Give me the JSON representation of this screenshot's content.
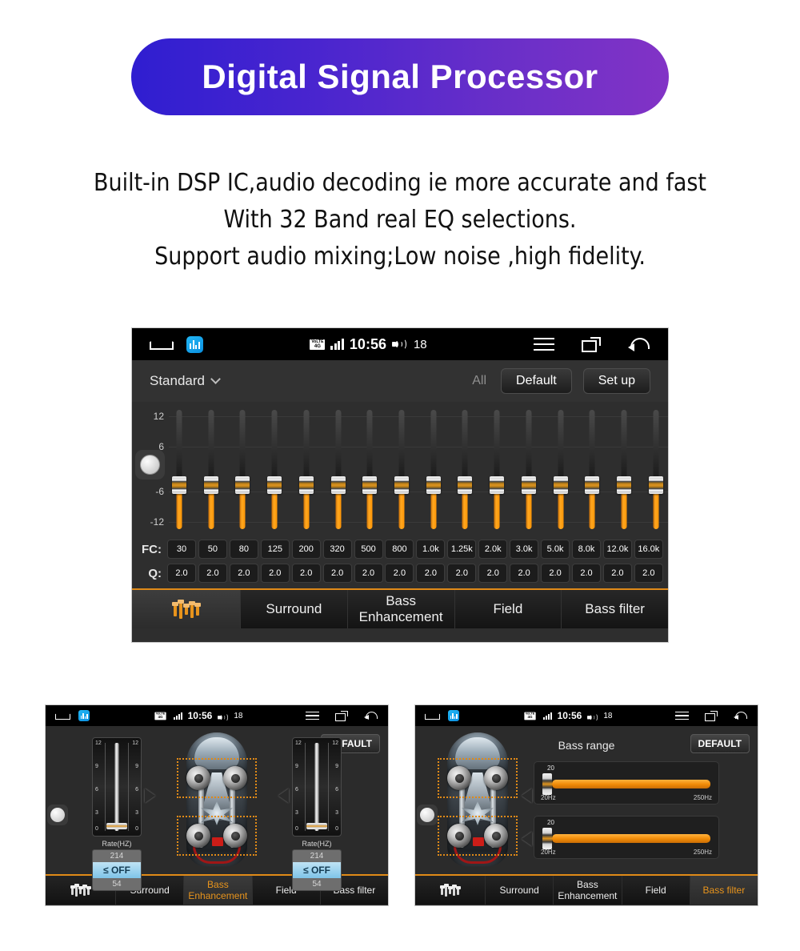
{
  "banner": {
    "title": "Digital Signal Processor",
    "gradient_from": "#2f1ed0",
    "gradient_to": "#8233c6"
  },
  "description": {
    "line1": "Built-in DSP IC,audio decoding ie more accurate and fast",
    "line2": "With 32 Band real EQ selections.",
    "line3": "Support audio mixing;Low noise ,high fidelity."
  },
  "statusbar": {
    "network_top": "VoLTE",
    "network_bottom": "4G",
    "time": "10:56",
    "volume": "18",
    "home_icon": "home-icon",
    "app_icon": "dsp-app-icon",
    "signal_icon": "signal-bars-icon",
    "volume_icon": "volume-icon",
    "menu_icon": "menu-icon",
    "recents_icon": "recents-icon",
    "back_icon": "back-icon"
  },
  "main_screen": {
    "preset": "Standard",
    "all_label": "All",
    "default_button": "Default",
    "setup_button": "Set up",
    "y_axis": [
      "12",
      "6",
      "-6",
      "-12"
    ],
    "fc_label": "FC:",
    "q_label": "Q:",
    "fc_values": [
      "30",
      "50",
      "80",
      "125",
      "200",
      "320",
      "500",
      "800",
      "1.0k",
      "1.25k",
      "2.0k",
      "3.0k",
      "5.0k",
      "8.0k",
      "12.0k",
      "16.0k"
    ],
    "q_values": [
      "2.0",
      "2.0",
      "2.0",
      "2.0",
      "2.0",
      "2.0",
      "2.0",
      "2.0",
      "2.0",
      "2.0",
      "2.0",
      "2.0",
      "2.0",
      "2.0",
      "2.0",
      "2.0"
    ],
    "tabs": [
      {
        "label": "",
        "icon": "equalizer-icon",
        "active": true
      },
      {
        "label": "Surround",
        "active": false
      },
      {
        "label": "Bass Enhancement",
        "active": false
      },
      {
        "label": "Field",
        "active": false
      },
      {
        "label": "Bass filter",
        "active": false
      }
    ],
    "accent_color": "#e8941c"
  },
  "left_screen": {
    "default_button": "DEFAULT",
    "rate_caption": "Rate(HZ)",
    "scale_labels": [
      "12",
      "9",
      "6",
      "3",
      "0"
    ],
    "value_top": "214",
    "value_selected": "≤ OFF",
    "value_bottom": "54",
    "tabs": [
      {
        "label": "",
        "icon": "equalizer-icon",
        "active": false
      },
      {
        "label": "Surround",
        "active": false
      },
      {
        "label": "Bass Enhancement",
        "active": true
      },
      {
        "label": "Field",
        "active": false
      },
      {
        "label": "Bass filter",
        "active": false
      }
    ]
  },
  "right_screen": {
    "default_button": "DEFAULT",
    "title": "Bass range",
    "slider_value": "20",
    "range_min": "20Hz",
    "range_max": "250Hz",
    "tabs": [
      {
        "label": "",
        "icon": "equalizer-icon",
        "active": false
      },
      {
        "label": "Surround",
        "active": false
      },
      {
        "label": "Bass Enhancement",
        "active": false
      },
      {
        "label": "Field",
        "active": false
      },
      {
        "label": "Bass filter",
        "active": true
      }
    ]
  }
}
